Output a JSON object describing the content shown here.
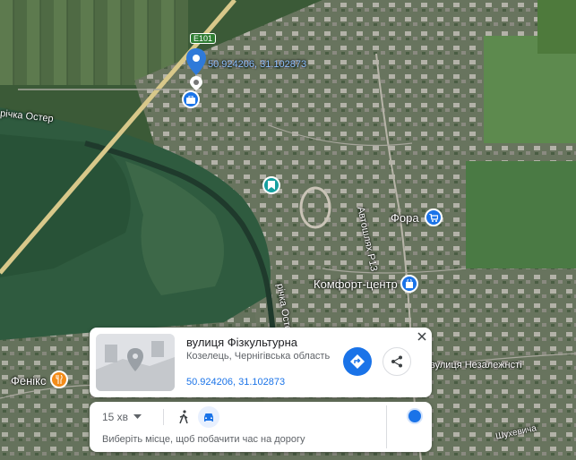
{
  "map": {
    "road_badge": "E101",
    "coords_label": "50.924206, 31.102873",
    "labels": {
      "river_ostr_top": "річка Остер",
      "river_ostr_side": "річка Остер",
      "highway": "Автошлях Р13",
      "fora": "Фора",
      "komfort": "Комфорт-центр",
      "feniks": "Фенікс",
      "nezalezhnosti": "вулиця Незалежнсті",
      "shukhevycha": "Шухевича"
    },
    "colors": {
      "pin_blue": "#2f7ad9",
      "poi_blue": "#1a73e8",
      "poi_teal": "#16a0a0",
      "poi_orange": "#f28c1a"
    }
  },
  "place_card": {
    "title": "вулиця Фізкультурна",
    "address": "Козелець, Чернігівська область",
    "coords": "50.924206, 31.102873"
  },
  "travel_card": {
    "time_label": "15 хв",
    "hint": "Виберіть місце, щоб побачити час на дорогу"
  }
}
